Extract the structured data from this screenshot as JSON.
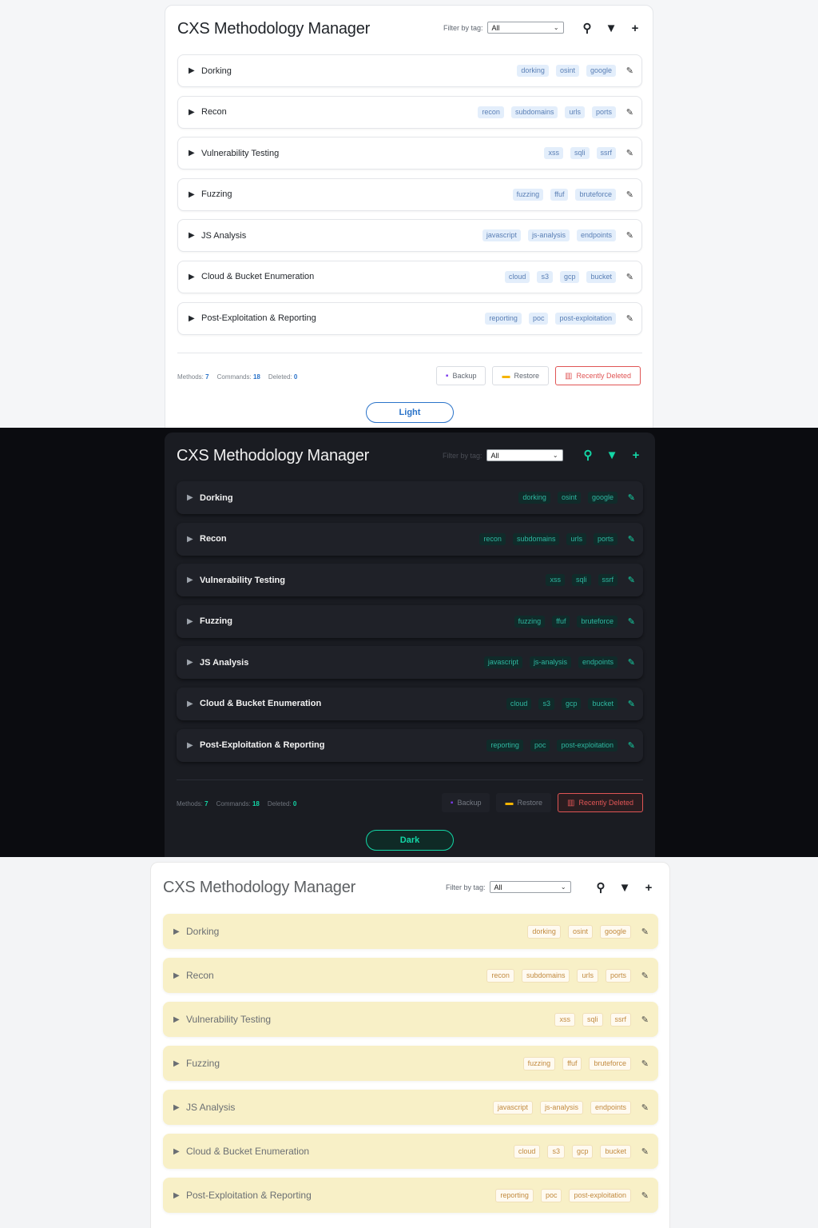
{
  "app_title": "CXS Methodology Manager",
  "filter": {
    "label": "Filter by tag:",
    "selected": "All"
  },
  "header_icons": {
    "search": "⚲",
    "filter": "▼",
    "add": "+"
  },
  "methods": [
    {
      "name": "Dorking",
      "tags": [
        "dorking",
        "osint",
        "google"
      ]
    },
    {
      "name": "Recon",
      "tags": [
        "recon",
        "subdomains",
        "urls",
        "ports"
      ]
    },
    {
      "name": "Vulnerability Testing",
      "tags": [
        "xss",
        "sqli",
        "ssrf"
      ]
    },
    {
      "name": "Fuzzing",
      "tags": [
        "fuzzing",
        "ffuf",
        "bruteforce"
      ]
    },
    {
      "name": "JS Analysis",
      "tags": [
        "javascript",
        "js-analysis",
        "endpoints"
      ]
    },
    {
      "name": "Cloud & Bucket Enumeration",
      "tags": [
        "cloud",
        "s3",
        "gcp",
        "bucket"
      ]
    },
    {
      "name": "Post-Exploitation & Reporting",
      "tags": [
        "reporting",
        "poc",
        "post-exploitation"
      ]
    }
  ],
  "stats": {
    "methods_label": "Methods:",
    "methods": "7",
    "commands_label": "Commands:",
    "commands": "18",
    "deleted_label": "Deleted:",
    "deleted": "0"
  },
  "footer": {
    "backup": "Backup",
    "restore": "Restore",
    "recently_deleted": "Recently Deleted"
  },
  "themes": {
    "light": "Light",
    "dark": "Dark"
  },
  "colors": {
    "light_accent": "#2a73c9",
    "dark_accent": "#13d6a6",
    "warm_row": "#f8f0c7",
    "danger": "#e05555"
  }
}
